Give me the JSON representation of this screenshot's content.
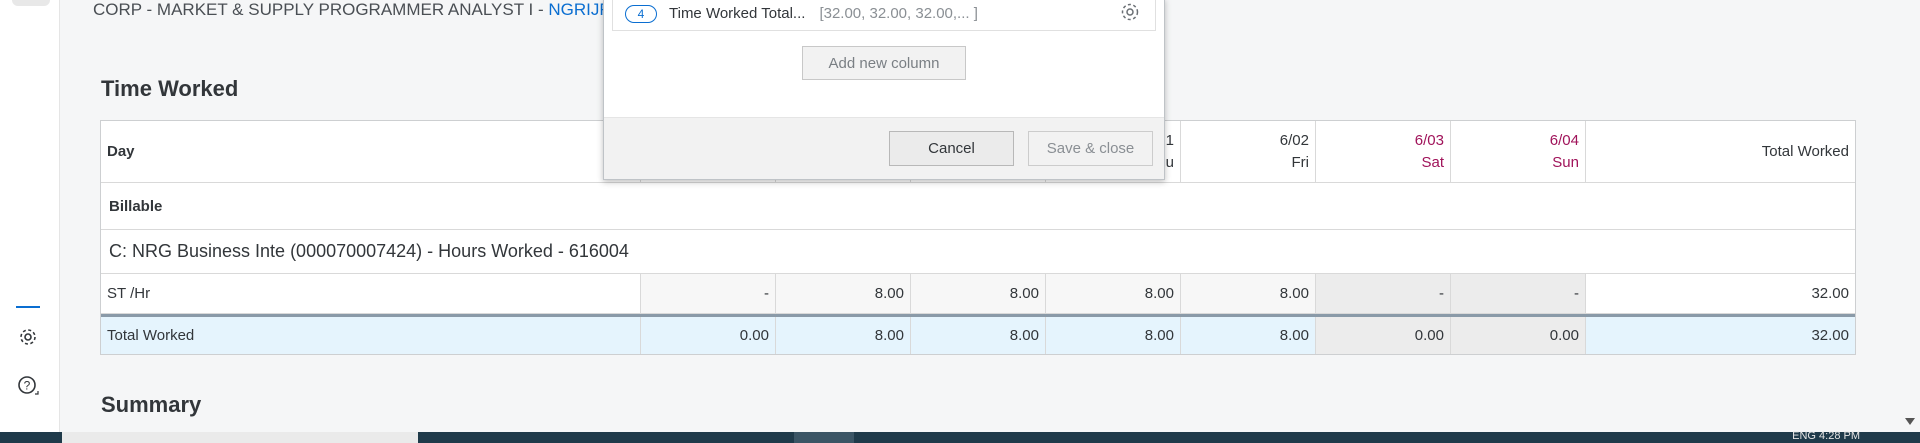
{
  "header": {
    "subtitle": "CORP - MARKET & SUPPLY PROGRAMMER ANALYST I - ",
    "subtitle_link": "NGRIJR"
  },
  "section_time_worked": {
    "title": "Time Worked"
  },
  "section_summary": {
    "title": "Summary"
  },
  "table": {
    "day_label": "Day",
    "columns": [
      {
        "date": "",
        "day": ""
      },
      {
        "date": "",
        "day": ""
      },
      {
        "date": "",
        "day": ""
      },
      {
        "date": "1",
        "day": "u"
      },
      {
        "date": "6/02",
        "day": "Fri"
      },
      {
        "date": "6/03",
        "day": "Sat"
      },
      {
        "date": "6/04",
        "day": "Sun"
      }
    ],
    "total_label": "Total Worked",
    "billable_label": "Billable",
    "contract_label": "C: NRG Business Inte (000070007424) - Hours Worked - 616004",
    "st_row": {
      "label": "ST /Hr",
      "values": [
        "-",
        "8.00",
        "8.00",
        "8.00",
        "8.00",
        "-",
        "-"
      ],
      "total": "32.00"
    },
    "total_row": {
      "label": "Total Worked",
      "values": [
        "0.00",
        "8.00",
        "8.00",
        "8.00",
        "8.00",
        "0.00",
        "0.00"
      ],
      "total": "32.00"
    }
  },
  "dialog": {
    "item": {
      "number": "4",
      "name": "Time Worked Total...",
      "values": "[32.00, 32.00, 32.00,...    ]"
    },
    "add_column": "Add new column",
    "cancel": "Cancel",
    "save_close": "Save & close"
  },
  "taskbar": {
    "tray_text": "ENG    4:28 PM"
  },
  "colors": {
    "accent": "#0a6ed1",
    "weekend": "#a0135a",
    "total_row_bg": "#e5f4fd"
  }
}
